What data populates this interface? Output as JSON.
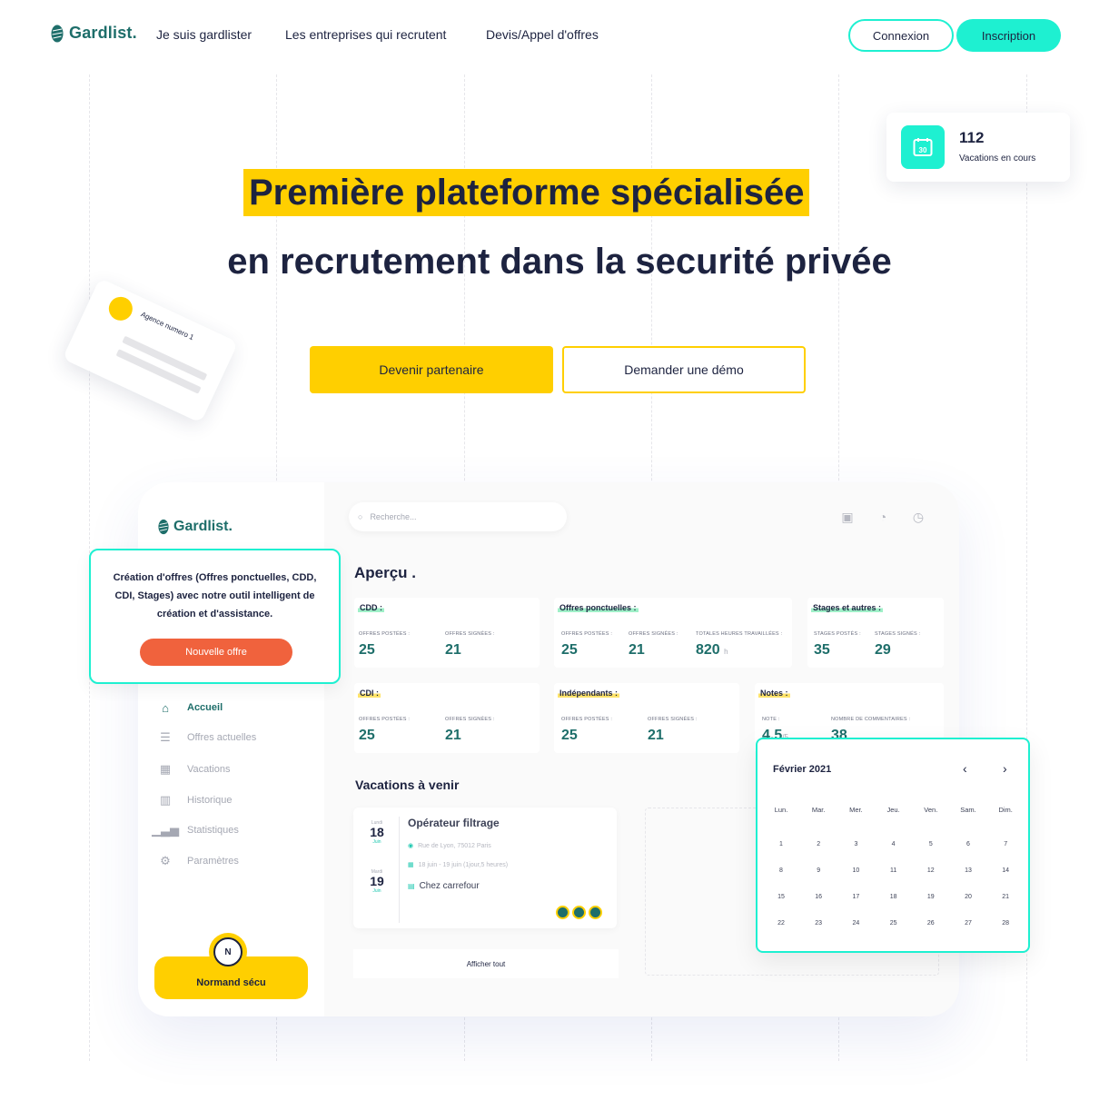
{
  "nav": {
    "brand": "Gardlist.",
    "links": [
      "Je suis gardlister",
      "Les entreprises qui recrutent",
      "Devis/Appel d'offres"
    ],
    "login": "Connexion",
    "signup": "Inscription"
  },
  "hero": {
    "line1": "Première plateforme spécialisée",
    "line2": "en recrutement dans la securité privée",
    "cta_primary": "Devenir partenaire",
    "cta_secondary": "Demander une démo"
  },
  "stat_card": {
    "icon_label": "30",
    "value": "112",
    "label": "Vacations en cours"
  },
  "agency_card": {
    "label": "Agence numero 1"
  },
  "dashboard": {
    "brand": "Gardlist.",
    "search_placeholder": "Recherche...",
    "title": "Aperçu .",
    "menu": [
      {
        "label": "Accueil",
        "icon": "home-icon"
      },
      {
        "label": "Offres actuelles",
        "icon": "list-icon"
      },
      {
        "label": "Vacations",
        "icon": "calendar-icon"
      },
      {
        "label": "Historique",
        "icon": "history-icon"
      },
      {
        "label": "Statistiques",
        "icon": "chart-icon"
      },
      {
        "label": "Paramètres",
        "icon": "settings-icon"
      }
    ],
    "user": {
      "name": "Normand sécu",
      "initials": "N"
    },
    "cards": {
      "cdd": {
        "title": "CDD :",
        "l1": "Offres postées :",
        "v1": "25",
        "l2": "Offres signées :",
        "v2": "21"
      },
      "ponct": {
        "title": "Offres ponctuelles :",
        "l1": "Offres postées :",
        "v1": "25",
        "l2": "Offres signées :",
        "v2": "21",
        "l3": "Totales heures travaillées :",
        "v3": "820",
        "u3": "h"
      },
      "stages": {
        "title": "Stages et autres :",
        "l1": "Stages postés :",
        "v1": "35",
        "l2": "Stages signés :",
        "v2": "29"
      },
      "cdi": {
        "title": "CDI :",
        "l1": "Offres postées :",
        "v1": "25",
        "l2": "Offres signées :",
        "v2": "21"
      },
      "indep": {
        "title": "Indépendants :",
        "l1": "Offres postées :",
        "v1": "25",
        "l2": "Offres signées :",
        "v2": "21"
      },
      "notes": {
        "title": "Notes :",
        "l1": "Note :",
        "v1": "4.5",
        "u1": "/5",
        "l2": "Nombre de commentaires :",
        "v2": "38"
      }
    },
    "upcoming_title": "Vacations à venir",
    "vacation": {
      "day1_label": "Lundi",
      "day1": "18",
      "month1": "Juin",
      "day2_label": "Mardi",
      "day2": "19",
      "month2": "Juin",
      "title": "Opérateur filtrage",
      "address": "Rue de Lyon, 75012 Paris",
      "dates": "18 juin - 19 juin (1jour,5 heures)",
      "client": "Chez carrefour"
    },
    "show_all": "Afficher tout"
  },
  "tooltip": {
    "text": "Création d'offres (Offres ponctuelles, CDD, CDI, Stages) avec notre outil intelligent de création et d'assistance.",
    "button": "Nouvelle offre"
  },
  "calendar": {
    "month": "Février 2021",
    "weekdays": [
      "Lun.",
      "Mar.",
      "Mer.",
      "Jeu.",
      "Ven.",
      "Sam.",
      "Dim."
    ],
    "days": [
      [
        "1",
        "2",
        "3",
        "4",
        "5",
        "6",
        "7"
      ],
      [
        "8",
        "9",
        "10",
        "11",
        "12",
        "13",
        "14"
      ],
      [
        "15",
        "16",
        "17",
        "18",
        "19",
        "20",
        "21"
      ],
      [
        "22",
        "23",
        "24",
        "25",
        "26",
        "27",
        "28"
      ]
    ]
  },
  "colors": {
    "primary_yellow": "#ffcf00",
    "accent_teal": "#1ef0d1",
    "brand_green": "#1e6e6a",
    "orange": "#f0623d",
    "navy": "#1d2340"
  }
}
